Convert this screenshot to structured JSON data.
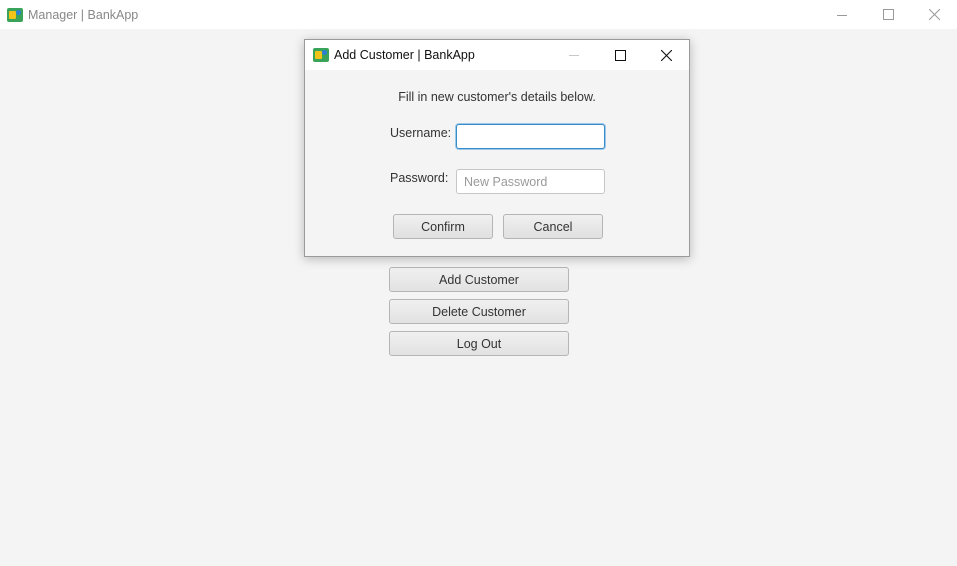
{
  "main_window": {
    "title": "Manager  |  BankApp",
    "menu": {
      "add_customer": "Add Customer",
      "delete_customer": "Delete Customer",
      "log_out": "Log Out"
    }
  },
  "dialog": {
    "title": "Add Customer  |  BankApp",
    "instructions": "Fill in new customer's details below.",
    "username": {
      "label": "Username:",
      "value": "",
      "placeholder": ""
    },
    "password": {
      "label": "Password:",
      "value": "",
      "placeholder": "New Password"
    },
    "confirm_label": "Confirm",
    "cancel_label": "Cancel"
  },
  "icons": {
    "app": "app-logo-icon",
    "minimize": "minimize-icon",
    "maximize": "maximize-icon",
    "close": "close-icon"
  }
}
